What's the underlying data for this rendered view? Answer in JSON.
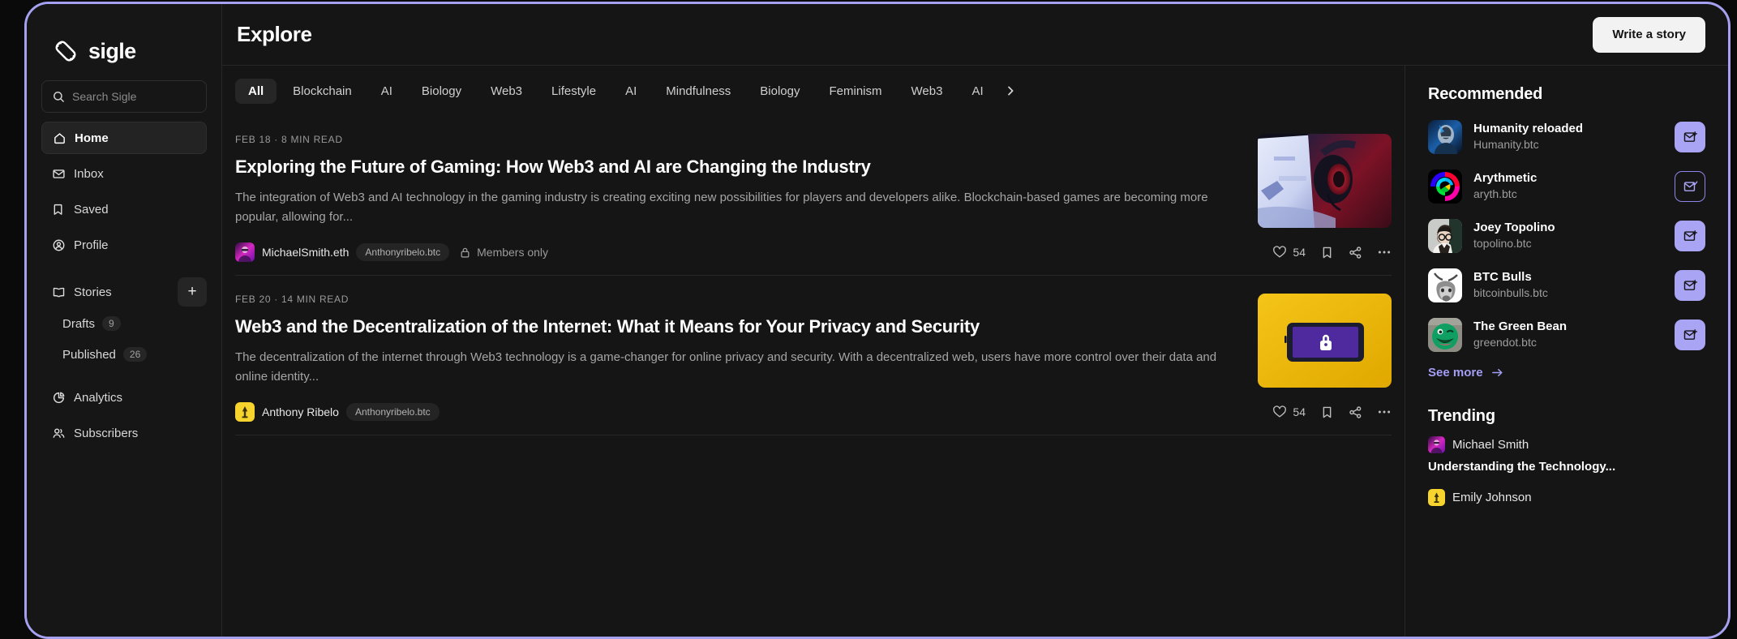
{
  "theme": {
    "frame_border": "#a5a1f0",
    "accent": "#aaa4f5",
    "background": "#151515",
    "sidebar_bg": "#161616",
    "divider": "#272727"
  },
  "sidebar": {
    "brand": "sigle",
    "search": {
      "placeholder": "Search Sigle",
      "value": ""
    },
    "nav": [
      {
        "label": "Home",
        "icon": "home-icon",
        "active": true
      },
      {
        "label": "Inbox",
        "icon": "mail-icon",
        "active": false
      },
      {
        "label": "Saved",
        "icon": "bookmark-icon",
        "active": false
      },
      {
        "label": "Profile",
        "icon": "user-circle-icon",
        "active": false
      }
    ],
    "stories": {
      "label": "Stories",
      "icon": "book-icon",
      "add_label": "+"
    },
    "sub_items": [
      {
        "label": "Drafts",
        "count": "9"
      },
      {
        "label": "Published",
        "count": "26"
      }
    ],
    "nav_bottom": [
      {
        "label": "Analytics",
        "icon": "pie-chart-icon"
      },
      {
        "label": "Subscribers",
        "icon": "users-icon"
      }
    ]
  },
  "topbar": {
    "title": "Explore",
    "write_button": "Write a story"
  },
  "tabs": {
    "items": [
      {
        "label": "All",
        "selected": true
      },
      {
        "label": "Blockchain",
        "selected": false
      },
      {
        "label": "AI",
        "selected": false
      },
      {
        "label": "Biology",
        "selected": false
      },
      {
        "label": "Web3",
        "selected": false
      },
      {
        "label": "Lifestyle",
        "selected": false
      },
      {
        "label": "AI",
        "selected": false
      },
      {
        "label": "Mindfulness",
        "selected": false
      },
      {
        "label": "Biology",
        "selected": false
      },
      {
        "label": "Feminism",
        "selected": false
      },
      {
        "label": "Web3",
        "selected": false
      },
      {
        "label": "AI",
        "selected": false
      }
    ],
    "next_icon": "chevron-right-icon"
  },
  "feed": {
    "stories": [
      {
        "date": "FEB 18",
        "read_time": "8 MIN READ",
        "separator": "·",
        "title": "Exploring the Future of Gaming: How Web3 and AI are Changing the Industry",
        "excerpt": "The integration of Web3 and AI technology in the gaming industry is creating exciting new possibilities for players and developers alike. Blockchain-based games are becoming more popular, allowing for...",
        "thumbnail": "gamer-with-headphones-photo",
        "author": "MichaelSmith.eth",
        "handle": "Anthonyribelo.btc",
        "avatar": "michael-smith-avatar",
        "members_only": "Members only",
        "lock_icon": "lock-icon",
        "likes": "54",
        "like_icon": "heart-icon",
        "bookmark_icon": "bookmark-icon",
        "share_icon": "share-icon",
        "more_icon": "ellipsis-icon"
      },
      {
        "date": "FEB 20",
        "read_time": "14 MIN READ",
        "separator": "·",
        "title": "Web3 and the Decentralization of the Internet: What it Means for Your Privacy and Security",
        "excerpt": "The decentralization of the internet through Web3 technology is a game-changer for online privacy and security. With a decentralized web, users have more control over their data and online identity...",
        "thumbnail": "yellow-phone-lock-photo",
        "author": "Anthony Ribelo",
        "handle": "Anthonyribelo.btc",
        "avatar": "anthony-ribelo-avatar",
        "members_only": "",
        "likes": "54",
        "like_icon": "heart-icon",
        "bookmark_icon": "bookmark-icon",
        "share_icon": "share-icon",
        "more_icon": "ellipsis-icon"
      }
    ]
  },
  "rail": {
    "recommended_title": "Recommended",
    "recommended": [
      {
        "name": "Humanity reloaded",
        "handle": "Humanity.btc",
        "avatar": "humanity-avatar",
        "subscribed": false,
        "button_icon": "mail-plus-icon"
      },
      {
        "name": "Arythmetic",
        "handle": "aryth.btc",
        "avatar": "arythmetic-avatar",
        "subscribed": true,
        "button_icon": "mail-check-icon"
      },
      {
        "name": "Joey Topolino",
        "handle": "topolino.btc",
        "avatar": "joey-topolino-avatar",
        "subscribed": false,
        "button_icon": "mail-plus-icon"
      },
      {
        "name": "BTC Bulls",
        "handle": "bitcoinbulls.btc",
        "avatar": "btc-bulls-avatar",
        "subscribed": false,
        "button_icon": "mail-plus-icon"
      },
      {
        "name": "The Green Bean",
        "handle": "greendot.btc",
        "avatar": "green-bean-avatar",
        "subscribed": false,
        "button_icon": "mail-plus-icon"
      }
    ],
    "see_more": "See more",
    "see_more_icon": "arrow-right-icon",
    "trending_title": "Trending",
    "trending": [
      {
        "author": "Michael Smith",
        "avatar": "michael-smith-avatar",
        "title": "Understanding the Technology..."
      },
      {
        "author": "Emily Johnson",
        "avatar": "emily-johnson-avatar",
        "title": ""
      }
    ]
  }
}
